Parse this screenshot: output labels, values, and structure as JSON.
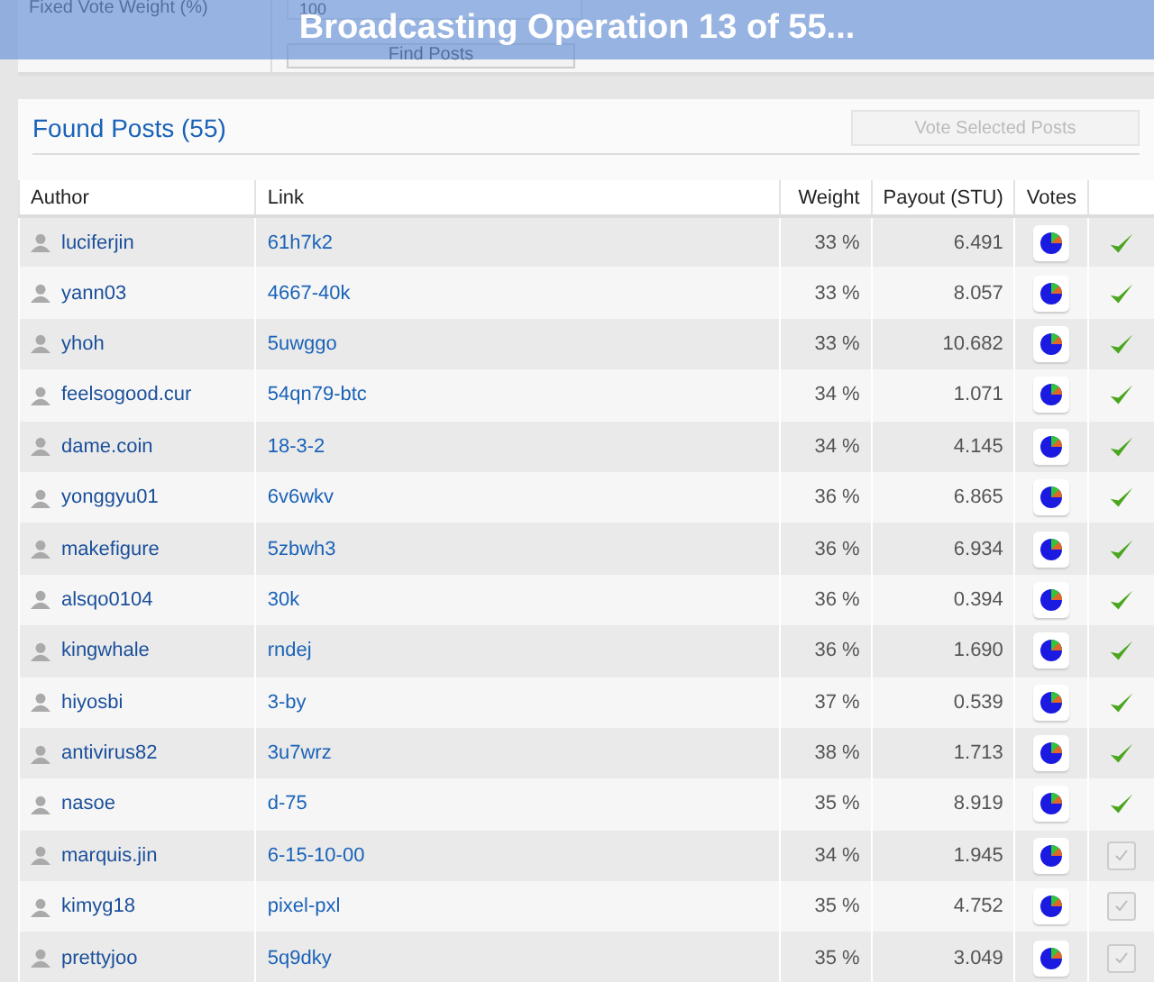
{
  "form": {
    "weight_label": "Fixed Vote Weight (%)",
    "weight_value": "100",
    "find_button": "Find Posts"
  },
  "overlay": {
    "message": "Broadcasting Operation 13 of 55..."
  },
  "found": {
    "title": "Found Posts (55)",
    "vote_button": "Vote Selected Posts"
  },
  "table": {
    "columns": [
      "Author",
      "Link",
      "Weight",
      "Payout (STU)",
      "Votes"
    ],
    "rows": [
      {
        "author": "luciferjin",
        "link": "61h7k2",
        "weight": "33 %",
        "payout": "6.491",
        "voted": true
      },
      {
        "author": "yann03",
        "link": "4667-40k",
        "weight": "33 %",
        "payout": "8.057",
        "voted": true
      },
      {
        "author": "yhoh",
        "link": "5uwggo",
        "weight": "33 %",
        "payout": "10.682",
        "voted": true
      },
      {
        "author": "feelsogood.cur",
        "link": "54qn79-btc",
        "weight": "34 %",
        "payout": "1.071",
        "voted": true
      },
      {
        "author": "dame.coin",
        "link": "18-3-2",
        "weight": "34 %",
        "payout": "4.145",
        "voted": true
      },
      {
        "author": "yonggyu01",
        "link": "6v6wkv",
        "weight": "36 %",
        "payout": "6.865",
        "voted": true
      },
      {
        "author": "makefigure",
        "link": "5zbwh3",
        "weight": "36 %",
        "payout": "6.934",
        "voted": true
      },
      {
        "author": "alsqo0104",
        "link": "30k",
        "weight": "36 %",
        "payout": "0.394",
        "voted": true
      },
      {
        "author": "kingwhale",
        "link": "rndej",
        "weight": "36 %",
        "payout": "1.690",
        "voted": true
      },
      {
        "author": "hiyosbi",
        "link": "3-by",
        "weight": "37 %",
        "payout": "0.539",
        "voted": true
      },
      {
        "author": "antivirus82",
        "link": "3u7wrz",
        "weight": "38 %",
        "payout": "1.713",
        "voted": true
      },
      {
        "author": "nasoe",
        "link": "d-75",
        "weight": "35 %",
        "payout": "8.919",
        "voted": true
      },
      {
        "author": "marquis.jin",
        "link": "6-15-10-00",
        "weight": "34 %",
        "payout": "1.945",
        "voted": false
      },
      {
        "author": "kimyg18",
        "link": "pixel-pxl",
        "weight": "35 %",
        "payout": "4.752",
        "voted": false
      },
      {
        "author": "prettyjoo",
        "link": "5q9dky",
        "weight": "35 %",
        "payout": "3.049",
        "voted": false
      }
    ]
  }
}
